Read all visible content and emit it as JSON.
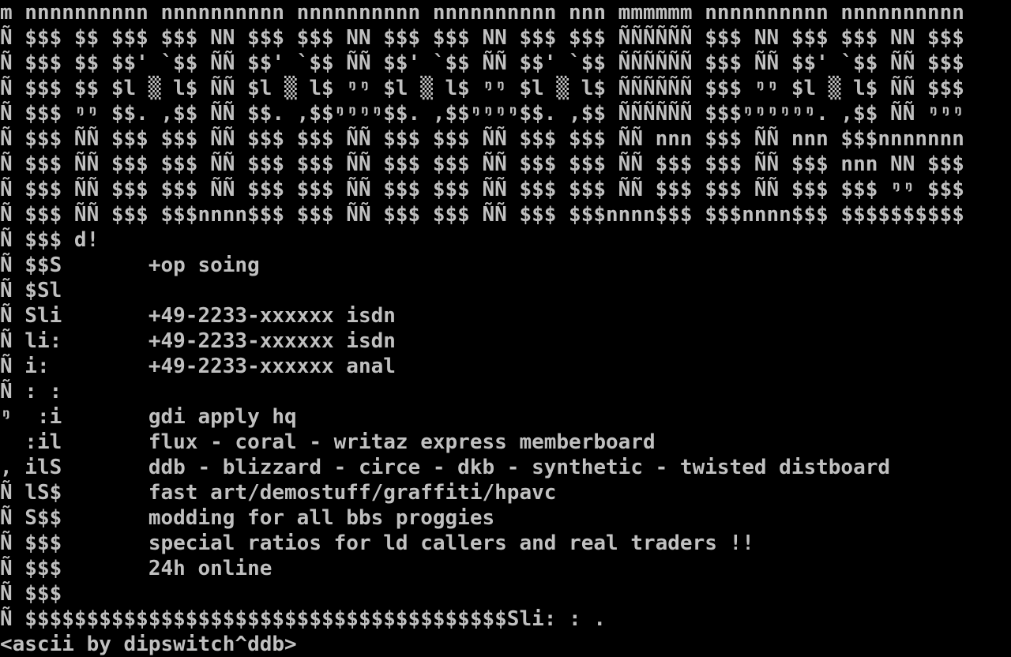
{
  "colors": {
    "background": "#000000",
    "foreground": "#c0c0c0"
  },
  "screen": {
    "lines": [
      "m nnnnnnnnnn nnnnnnnnnn nnnnnnnnnn nnnnnnnnnn nnn mmmmmm nnnnnnnnnn nnnnnnnnnn",
      "Ñ $$$ $$ $$$ $$$ NN $$$ $$$ NN $$$ $$$ NN $$$ $$$ ÑÑÑÑÑÑ $$$ NN $$$ $$$ NN $$$",
      "Ñ $$$ $$ $$' `$$ ÑÑ $$' `$$ ÑÑ $$' `$$ ÑÑ $$' `$$ ÑÑÑÑÑÑ $$$ ÑÑ $$' `$$ ÑÑ $$$",
      "Ñ $$$ $$ $l ▒ l$ ÑÑ $l ▒ l$ ᵑᵑ $l ▒ l$ ᵑᵑ $l ▒ l$ ÑÑÑÑÑÑ $$$ ᵑᵑ $l ▒ l$ ÑÑ $$$",
      "Ñ $$$ ᵑᵑ $$. ,$$ ÑÑ $$. ,$$ᵑᵑᵑᵑ$$. ,$$ᵑᵑᵑᵑ$$. ,$$ ÑÑÑÑÑÑ $$$ᵑᵑᵑᵑᵑᵑ. ,$$ ÑÑ ᵑᵑᵑ",
      "Ñ $$$ ÑÑ $$$ $$$ ÑÑ $$$ $$$ ÑÑ $$$ $$$ ÑÑ $$$ $$$ ÑÑ nnn $$$ ÑÑ nnn $$$nnnnnnn",
      "Ñ $$$ ÑÑ $$$ $$$ ÑÑ $$$ $$$ ÑÑ $$$ $$$ ÑÑ $$$ $$$ ÑÑ $$$ $$$ ÑÑ $$$ nnn NN $$$",
      "Ñ $$$ ÑÑ $$$ $$$ ÑÑ $$$ $$$ ÑÑ $$$ $$$ ÑÑ $$$ $$$ ÑÑ $$$ $$$ ÑÑ $$$ $$$ ᵑᵑ $$$",
      "Ñ $$$ ÑÑ $$$ $$$nnnn$$$ $$$ ÑÑ $$$ $$$ ÑÑ $$$ $$$nnnn$$$ $$$nnnn$$$ $$$$$$$$$$",
      "Ñ $$$ d!",
      "Ñ $$S       +op soing",
      "Ñ $Sl",
      "Ñ Sli       +49-2233-xxxxxx isdn",
      "Ñ li:       +49-2233-xxxxxx isdn",
      "Ñ i:        +49-2233-xxxxxx anal",
      "Ñ : :",
      "ᵑ  :i       gdi apply hq",
      "  :il       flux - coral - writaz express memberboard",
      ", ilS       ddb - blizzard - circe - dkb - synthetic - twisted distboard",
      "Ñ lS$       fast art/demostuff/graffiti/hpavc",
      "Ñ S$$       modding for all bbs proggies",
      "Ñ $$$       special ratios for ld callers and real traders !!",
      "Ñ $$$       24h online",
      "Ñ $$$",
      "Ñ $$$$$$$$$$$$$$$$$$$$$$$$$$$$$$$$$$$$$$$Sli: : .",
      "<ascii by dipswitch^ddb>"
    ]
  }
}
